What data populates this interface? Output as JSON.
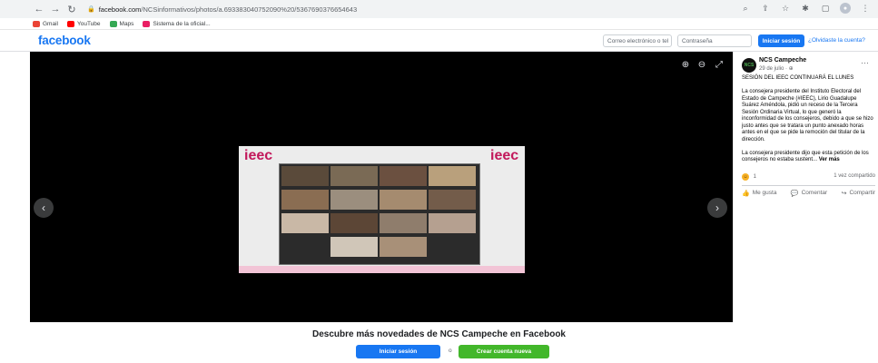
{
  "browser": {
    "url_host": "facebook.com",
    "url_path": "/NCSinformativos/photos/a.693383040752090%20/5367690376654643",
    "bookmarks": [
      {
        "label": "Gmail",
        "color": "#ea4335"
      },
      {
        "label": "YouTube",
        "color": "#ff0000"
      },
      {
        "label": "Maps",
        "color": "#34a853"
      },
      {
        "label": "Sistema de la oficial...",
        "color": "#e91e63"
      }
    ]
  },
  "header": {
    "logo": "facebook",
    "email_placeholder": "Correo electrónico o tel",
    "password_placeholder": "Contraseña",
    "login_label": "Iniciar sesión",
    "forgot_label": "¿Olvidaste la cuenta?"
  },
  "photo": {
    "brand_text": "ieec",
    "brand_color": "#c2185b"
  },
  "post": {
    "page_name": "NCS Campeche",
    "avatar_text": "NCS",
    "date": "29 de julio · ⊕",
    "paragraphs": [
      "SESIÓN DEL IEEC CONTINUARÁ EL LUNES",
      "La consejera presidente del Instituto Electoral del Estado de Campeche (#IEEC), Lirio Guadalupe Suárez Améndola, pidió un receso de la Tercera Sesión Ordinaria Virtual, lo que generó la inconformidad de los consejeros, debido a que se hizo justo antes que se tratara un punto anexado horas antes en el que se pide la remoción del titular de la dirección."
    ],
    "last_paragraph": "La consejera presidente dijo que esta petición de los consejeros no estaba sustent...",
    "see_more": "Ver más",
    "reaction_count": "1",
    "shares": "1 vez compartido",
    "actions": {
      "like": "Me gusta",
      "comment": "Comentar",
      "share": "Compartir"
    }
  },
  "banner": {
    "title": "Descubre más novedades de NCS Campeche en Facebook",
    "login": "Iniciar sesión",
    "or": "o",
    "create": "Crear cuenta nueva"
  }
}
